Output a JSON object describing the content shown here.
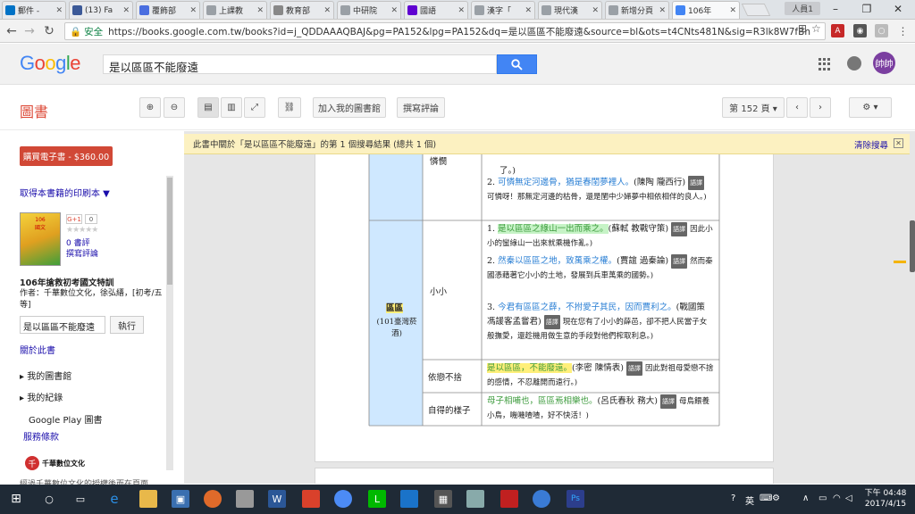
{
  "tabs": [
    {
      "label": "郵件 - ",
      "icon": "outlook-icon",
      "color": "#0072c6"
    },
    {
      "label": "(13) Fa",
      "icon": "facebook-icon",
      "color": "#3b5998"
    },
    {
      "label": "覆飾部",
      "icon": "chat-icon",
      "color": "#4a6ee0"
    },
    {
      "label": "上課教",
      "icon": "page-icon",
      "color": "#9aa0a6"
    },
    {
      "label": "教育部",
      "icon": "edu-icon",
      "color": "#888888"
    },
    {
      "label": "中研院",
      "icon": "page-icon",
      "color": "#9aa0a6"
    },
    {
      "label": "國語",
      "icon": "yahoo-icon",
      "color": "#5f01d1"
    },
    {
      "label": "漢字「",
      "icon": "page-icon",
      "color": "#9aa0a6"
    },
    {
      "label": "現代漢",
      "icon": "page-icon",
      "color": "#9aa0a6"
    },
    {
      "label": "新增分頁",
      "icon": "page-icon",
      "color": "#9aa0a6"
    },
    {
      "label": "106年",
      "icon": "google-icon",
      "color": "#4285f4",
      "active": true
    }
  ],
  "window": {
    "user_badge": "人員1",
    "min": "–",
    "max": "❐",
    "close": "✕"
  },
  "address": {
    "secure_label": "安全",
    "url": "https://books.google.com.tw/books?id=j_QDDAAAQBAJ&pg=PA152&lpg=PA152&dq=是以區區不能廢遠&source=bl&ots=t4CNts481N&sig=R3lk8W7fBn"
  },
  "header": {
    "logo_letters": [
      "G",
      "o",
      "o",
      "g",
      "l",
      "e"
    ],
    "logo_colors": [
      "#4285f4",
      "#ea4335",
      "#fbbc05",
      "#4285f4",
      "#34a853",
      "#ea4335"
    ],
    "search_value": "是以區區不能廢遠",
    "avatar_text": "帥帥"
  },
  "toolbar": {
    "books_label": "圖書",
    "add_library": "加入我的圖書館",
    "write_review": "撰寫評論",
    "page_label": "第 152 頁 ▾",
    "prev": "‹",
    "next": "›",
    "settings": "⚙ ▾"
  },
  "sidebar": {
    "buy_label": "購買電子書 - $360.00",
    "print_link": "取得本書籍的印刷本 ▼",
    "gplus": "G+1",
    "gplus_count": "0",
    "stars": "★★★★★",
    "reviews": "0 書評",
    "write_review": "撰寫評論",
    "book_title": "106年搶救初考國文特訓",
    "book_author": "作者：千華數位文化，徐弘縉，[初考/五等]",
    "search_in_book": "是以區區不能廢遠",
    "exec_button": "執行",
    "about_link": "關於此書",
    "my_library": "我的圖書館",
    "my_history": "我的紀錄",
    "play_books": "Google Play 圖書",
    "terms": "服務條款",
    "publisher": "千華數位文化",
    "footnote": "經過千華數位文化的授權後而在頁面..."
  },
  "viewer": {
    "banner_text": "此書中關於「是以區區不能廢遠」的第 1 個搜尋結果 (總共 1 個)",
    "clear_search": "清除搜尋"
  },
  "page": {
    "row1_head": "憐憫",
    "row1_top": "了。)",
    "row1_item2a": "可憐無定河邊骨，猶是春閨夢裡人。",
    "row1_item2b": "(陳陶 隴西行)",
    "row1_item2c": "可憐呀！那無定河邊的枯骨，還是閨中少婦夢中相依相伴的良人。)",
    "term": "區區",
    "term_note": "(101臺灣菸酒)",
    "row2_head": "小小",
    "row2_item1a": "是以區區之綠山一出而乘之。",
    "row2_item1b": "(蘇軾 教戰守策)",
    "row2_item1c": "因此小小的蠻綠山一出來就乘機作亂。)",
    "row2_item2a": "然秦以區區之地，致萬乘之權。",
    "row2_item2b": "(賈誼 過秦論)",
    "row2_item2c": "然而秦國憑藉著它小小的土地，發展到兵車萬乘的國勢。)",
    "row2_item3a": "今君有區區之薛，不拊愛子其民，因而賈利之。",
    "row2_item3b": "(戰國策 馮諼客孟嘗君)",
    "row2_item3c": "現在您有了小小的薛邑，卻不把人民當子女般撫愛，還趁機用做生意的手段對他們榨取利息。)",
    "row3_head": "依戀不捨",
    "row3_a": "是以區區，不能廢遠。",
    "row3_b": "(李密 陳情表)",
    "row3_c": "因此對祖母愛戀不捨的感情，不忍離開而遠行。)",
    "row4_head": "自得的樣子",
    "row4_a": "母子相哺也，區區焉相樂也。",
    "row4_b": "(呂氏春秋 務大)",
    "row4_c": "母鳥餵養小鳥，嘰嘰喳喳，好不快活！)",
    "tag_label": "語譯",
    "num1": "1.",
    "num2": "2.",
    "num3": "3."
  },
  "taskbar": {
    "tray_lang": "英",
    "clock_time": "下午 04:48",
    "clock_date": "2017/4/15"
  }
}
